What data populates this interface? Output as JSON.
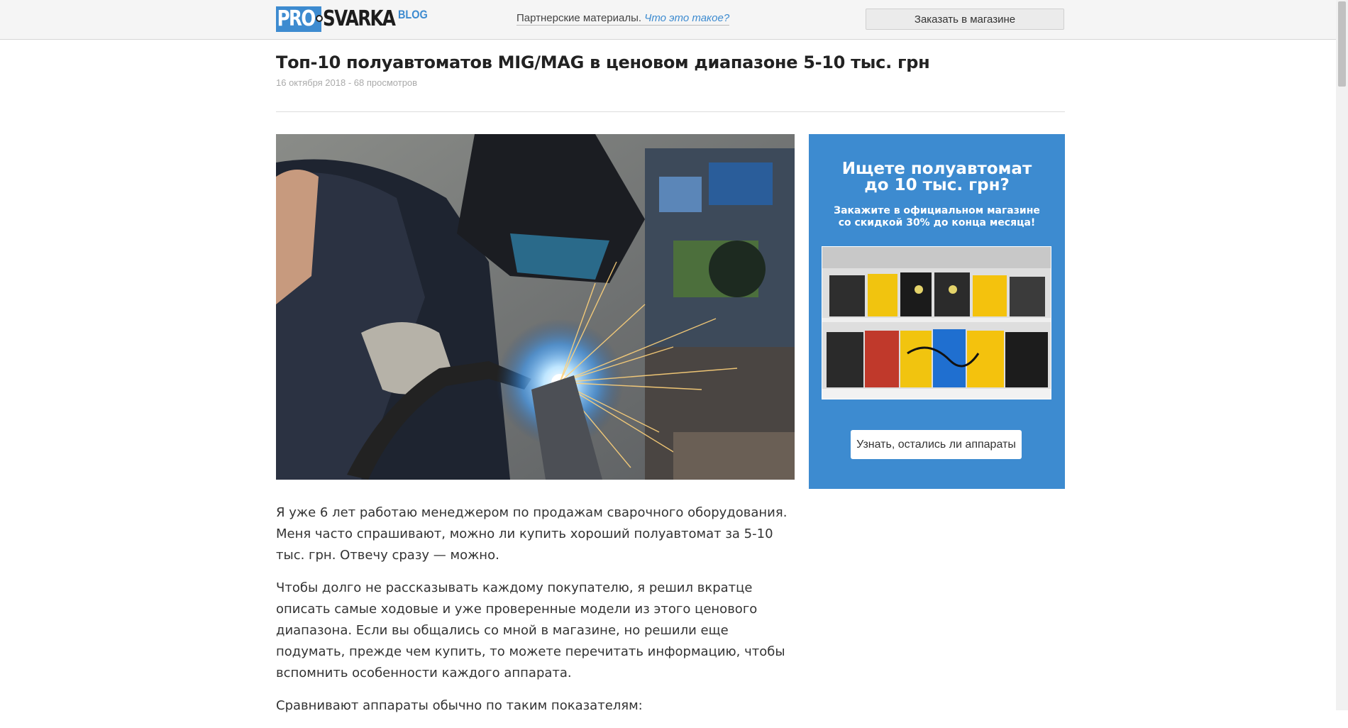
{
  "header": {
    "logo_pro": "PRO",
    "logo_svarka": "SVARKA",
    "logo_blog": "BLOG",
    "partner_text": "Партнерские материалы.",
    "partner_link": "Что это такое?",
    "order_button": "Заказать в магазине"
  },
  "article": {
    "title": "Топ-10 полуавтоматов MIG/MAG в ценовом диапазоне 5-10 тыс. грн",
    "meta": "16 октября 2018 - 68 просмотров",
    "paragraphs": [
      "Я уже 6 лет работаю менеджером по продажам сварочного оборудования. Меня часто спрашивают, можно ли купить хороший полуавтомат за 5-10 тыс. грн. Отвечу сразу — можно.",
      "Чтобы долго не рассказывать каждому покупателю, я решил вкратце описать самые ходовые и уже проверенные модели из этого ценового диапазона. Если вы общались со мной в магазине, но решили еще подумать, прежде чем купить, то можете перечитать информацию, чтобы вспомнить особенности каждого аппарата.",
      "Сравнивают аппараты обычно по таким показателям:"
    ]
  },
  "ad": {
    "title_line1": "Ищете полуавтомат",
    "title_line2": "до 10 тыс. грн?",
    "sub_line1": "Закажите в официальном магазине",
    "sub_line2": "со скидкой 30% до конца месяца!",
    "button": "Узнать, остались ли аппараты"
  },
  "colors": {
    "accent": "#3d8bd0",
    "topbar_bg": "#f5f5f5"
  }
}
